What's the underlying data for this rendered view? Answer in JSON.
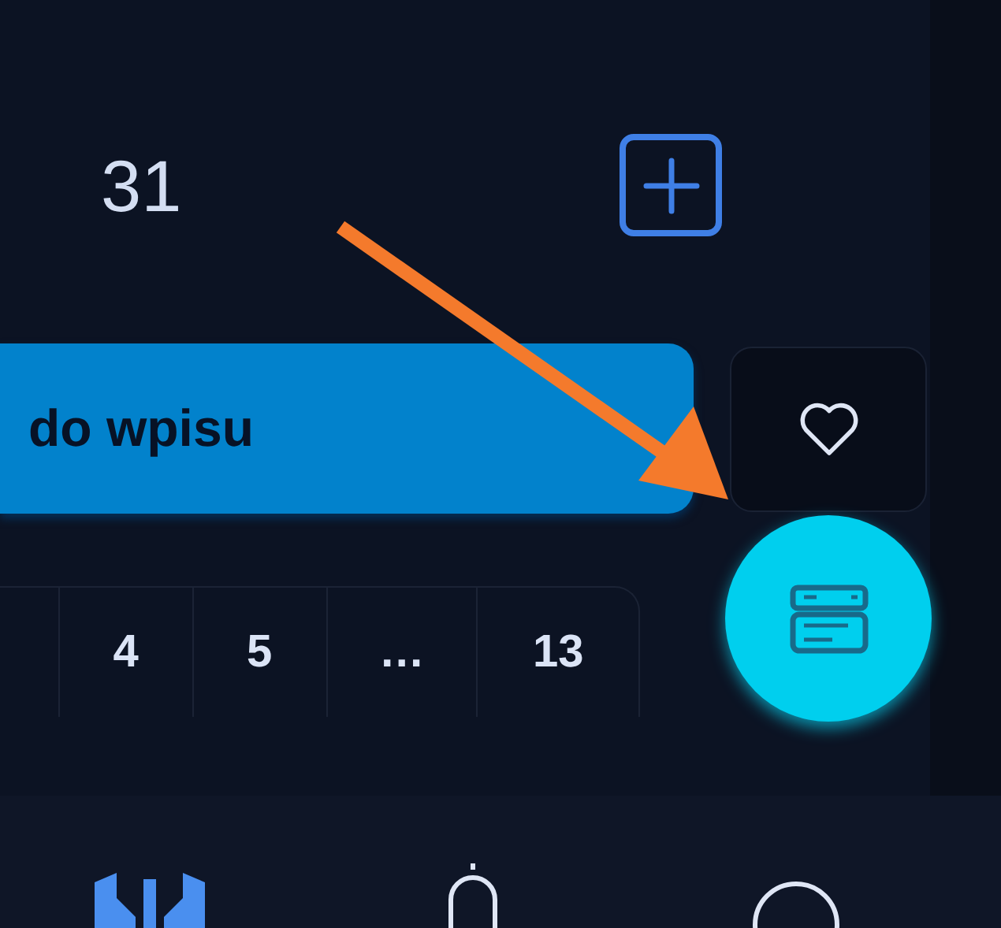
{
  "header": {
    "count": "31"
  },
  "entry_button": {
    "label": "do wpisu"
  },
  "pagination": {
    "pages": [
      {
        "label": "4"
      },
      {
        "label": "5"
      },
      {
        "label": "…"
      },
      {
        "label": "13"
      }
    ]
  }
}
